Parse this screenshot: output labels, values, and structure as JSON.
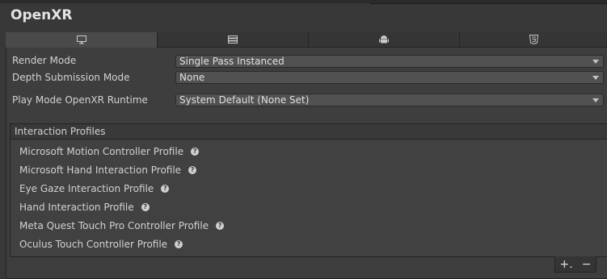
{
  "title": "OpenXR",
  "tabs": [
    {
      "icon": "monitor-icon"
    },
    {
      "icon": "server-icon"
    },
    {
      "icon": "android-icon"
    },
    {
      "icon": "html5-icon"
    }
  ],
  "settings": {
    "render_mode": {
      "label": "Render Mode",
      "value": "Single Pass Instanced"
    },
    "depth_submission": {
      "label": "Depth Submission Mode",
      "value": "None"
    },
    "play_mode_runtime": {
      "label": "Play Mode OpenXR Runtime",
      "value": "System Default (None Set)"
    }
  },
  "interaction_profiles": {
    "header": "Interaction Profiles",
    "items": [
      "Microsoft Motion Controller Profile",
      "Microsoft Hand Interaction Profile",
      "Eye Gaze Interaction Profile",
      "Hand Interaction Profile",
      "Meta Quest Touch Pro Controller Profile",
      "Oculus Touch Controller Profile"
    ],
    "help_glyph": "?",
    "add_label": "+.",
    "remove_label": "−"
  }
}
